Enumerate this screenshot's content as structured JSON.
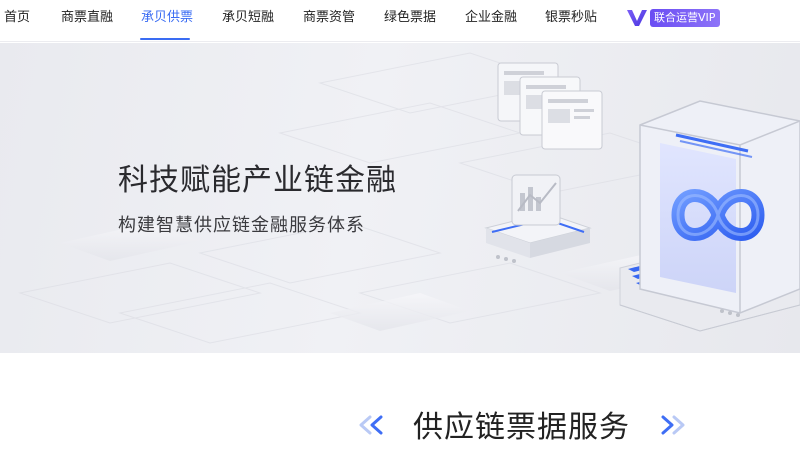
{
  "nav": {
    "items": [
      {
        "label": "首页",
        "active": false
      },
      {
        "label": "商票直融",
        "active": false
      },
      {
        "label": "承贝供票",
        "active": true
      },
      {
        "label": "承贝短融",
        "active": false
      },
      {
        "label": "商票资管",
        "active": false
      },
      {
        "label": "绿色票据",
        "active": false
      },
      {
        "label": "企业金融",
        "active": false
      },
      {
        "label": "银票秒贴",
        "active": false
      }
    ],
    "vip_label": "联合运营VIP",
    "active_color": "#3a6cf3"
  },
  "banner": {
    "title": "科技赋能产业链金融",
    "subtitle": "构建智慧供应链金融服务体系"
  },
  "section": {
    "title": "供应链票据服务"
  },
  "icons": [
    "vip-logo-icon",
    "chevron-left-double-icon",
    "chevron-right-double-icon",
    "infinity-cube-illustration",
    "chart-card-illustration",
    "document-cards-illustration"
  ]
}
